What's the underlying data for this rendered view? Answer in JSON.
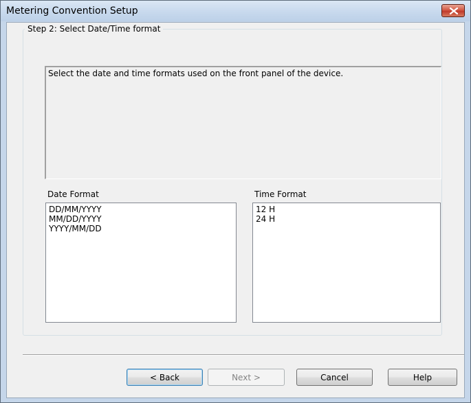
{
  "window": {
    "title": "Metering Convention Setup",
    "close_icon": "close-x-icon"
  },
  "step": {
    "caption": "Step 2: Select Date/Time format",
    "description": "Select the date and time formats used on the front panel of the device."
  },
  "date_format": {
    "label": "Date Format",
    "items": [
      "DD/MM/YYYY",
      "MM/DD/YYYY",
      "YYYY/MM/DD"
    ]
  },
  "time_format": {
    "label": "Time Format",
    "items": [
      "12 H",
      "24 H"
    ]
  },
  "buttons": {
    "back": "< Back",
    "next": "Next >",
    "cancel": "Cancel",
    "help": "Help"
  },
  "colors": {
    "title_bar": "#c5d6ea",
    "close_button": "#c0392b",
    "client_bg": "#f0f0f0"
  }
}
